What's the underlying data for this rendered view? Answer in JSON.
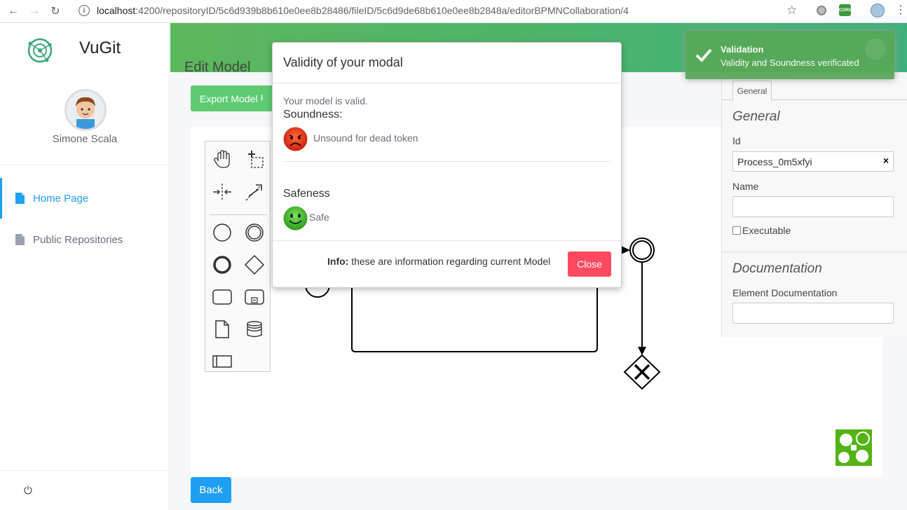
{
  "browser": {
    "url_host": "localhost",
    "url_path": ":4200/repositoryID/5c6d939b8b610e0ee8b28486/fileID/5c6d9de68b610e0ee8b2848a/editorBPMNCollaboration/4",
    "ext_label": "CORS"
  },
  "sidebar": {
    "brand": "VuGit",
    "user_name": "Simone Scala",
    "items": [
      {
        "label": "Home Page"
      },
      {
        "label": "Public Repositories"
      }
    ]
  },
  "main": {
    "heading": "Edit Model",
    "export_label": "Export Model",
    "back_label": "Back"
  },
  "properties": {
    "tab": "General",
    "group_general": "General",
    "id_label": "Id",
    "id_value": "Process_0m5xfyi",
    "name_label": "Name",
    "executable_label": "Executable",
    "group_documentation": "Documentation",
    "element_doc_label": "Element Documentation"
  },
  "toast": {
    "title": "Validation",
    "message": "Validity and Soundness verificated"
  },
  "modal": {
    "title": "Validity of your modal",
    "valid_text": "Your model is valid.",
    "soundness_label": "Soundness:",
    "soundness_result": "Unsound for dead token",
    "safeness_label": "Safeness",
    "safeness_result": "Safe",
    "info_bold": "Info:",
    "info_text": " these are information regarding current Model",
    "close_label": "Close"
  },
  "colors": {
    "accent_blue": "#1e9ff2",
    "success_green": "#5ecb73",
    "danger_red": "#ff4961",
    "banner_green": "#4cb568"
  }
}
